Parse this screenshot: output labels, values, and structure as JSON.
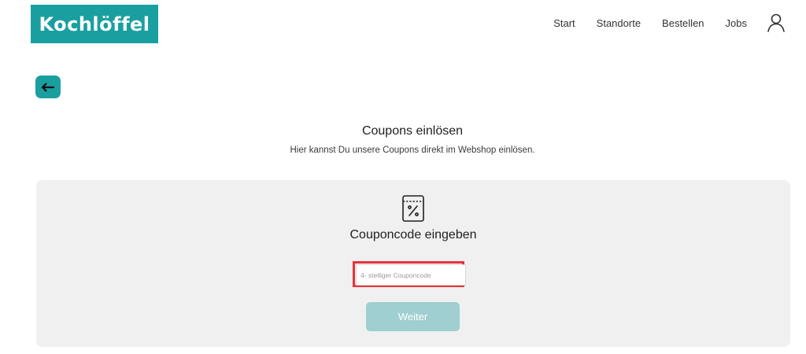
{
  "header": {
    "logo_text": "Kochlöffel",
    "nav": {
      "start": "Start",
      "standorte": "Standorte",
      "bestellen": "Bestellen",
      "jobs": "Jobs"
    },
    "user_icon": "user-icon"
  },
  "back_icon": "arrow-left-icon",
  "main": {
    "title": "Coupons einlösen",
    "subtitle": "Hier kannst Du unsere Coupons direkt im Webshop einlösen."
  },
  "coupon_panel": {
    "icon": "coupon-percent-icon",
    "title": "Couponcode eingeben",
    "input_value": "",
    "input_placeholder": "4- stelliger Couponcode",
    "button_label": "Weiter"
  },
  "colors": {
    "brand_teal": "#1a9fa0",
    "button_teal_disabled": "#9fcfd0",
    "highlight_red": "#e8333a",
    "panel_bg": "#f0f0f0"
  }
}
